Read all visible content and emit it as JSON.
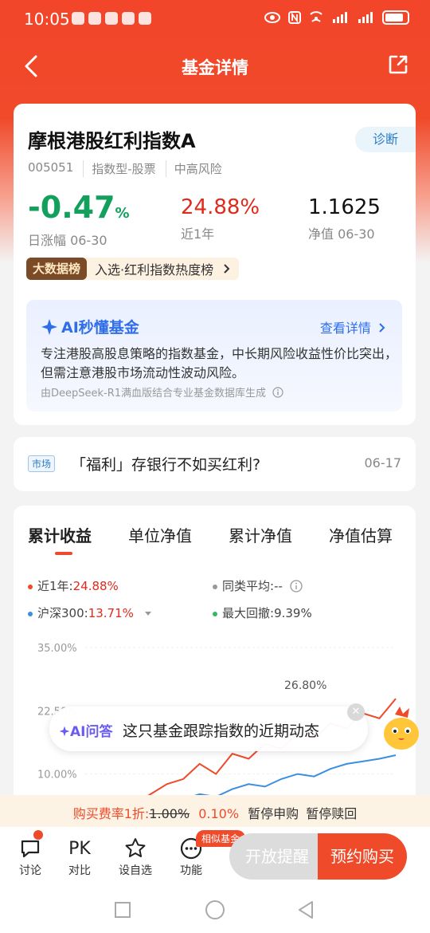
{
  "status": {
    "time": "10:05"
  },
  "nav": {
    "title": "基金详情"
  },
  "fund": {
    "name": "摩根港股红利指数A",
    "diagnose": "诊断",
    "code": "005051",
    "type": "指数型-股票",
    "risk": "中高风险",
    "daily_value": "-0.47",
    "daily_unit": "%",
    "daily_label": "日涨幅 06-30",
    "year_value": "24.88%",
    "year_label": "近1年",
    "nav_value": "1.1625",
    "nav_label": "净值 06-30",
    "rank_tag": "大数据榜",
    "rank_text": "入选·红利指数热度榜"
  },
  "ai": {
    "title": "AI秒懂基金",
    "more": "查看详情",
    "text": "专注港股高股息策略的指数基金，中长期风险收益性价比突出，但需注意港股市场流动性波动风险。",
    "source": "由DeepSeek-R1满血版结合专业基金数据库生成"
  },
  "news": {
    "tag": "市场",
    "title": "「福利」存银行不如买红利?",
    "date": "06-17"
  },
  "chart_tabs": [
    "累计收益",
    "单位净值",
    "累计净值",
    "净值估算"
  ],
  "legend": {
    "year_label": "近1年:",
    "year_value": "24.88%",
    "peer_label": "同类平均:",
    "peer_value": "--",
    "hs300_label": "沪深300:",
    "hs300_value": "13.71%",
    "drawdown_label": "最大回撤:",
    "drawdown_value": "9.39%"
  },
  "chart_data": {
    "type": "line",
    "ytick_labels": [
      "35.00%",
      "22.50%",
      "10.00%"
    ],
    "ylim": [
      0,
      35
    ],
    "annotations": [
      "26.80%"
    ],
    "series": [
      {
        "name": "近1年",
        "color": "#ef4a2a",
        "values": [
          0,
          2,
          1,
          4,
          6,
          8,
          9,
          12,
          10,
          14,
          13,
          16,
          15,
          18,
          17,
          20,
          19,
          22,
          21,
          24.88
        ]
      },
      {
        "name": "沪深300",
        "color": "#3b8fe0",
        "values": [
          0,
          1,
          0.5,
          2,
          3,
          4,
          5,
          6,
          5.5,
          7,
          8,
          7.5,
          9,
          10,
          9.5,
          11,
          12,
          12.5,
          13,
          13.71
        ]
      }
    ]
  },
  "ai_ask": {
    "label": "AI问答",
    "question": "这只基金跟踪指数的近期动态"
  },
  "fee": {
    "prefix": "购买费率1折:",
    "original": "1.00%",
    "discount": "0.10%",
    "purchase": "暂停申购",
    "redeem": "暂停赎回"
  },
  "bottom": {
    "discuss": "讨论",
    "compare_icon": "PK",
    "compare": "对比",
    "watch": "设自选",
    "func": "功能",
    "similar": "相似基金",
    "remind": "开放提醒",
    "buy": "预约购买"
  },
  "colors": {
    "brand": "#ef4a2a",
    "up": "#e02a1d",
    "down": "#12a05c",
    "ai": "#2f6ee8"
  }
}
